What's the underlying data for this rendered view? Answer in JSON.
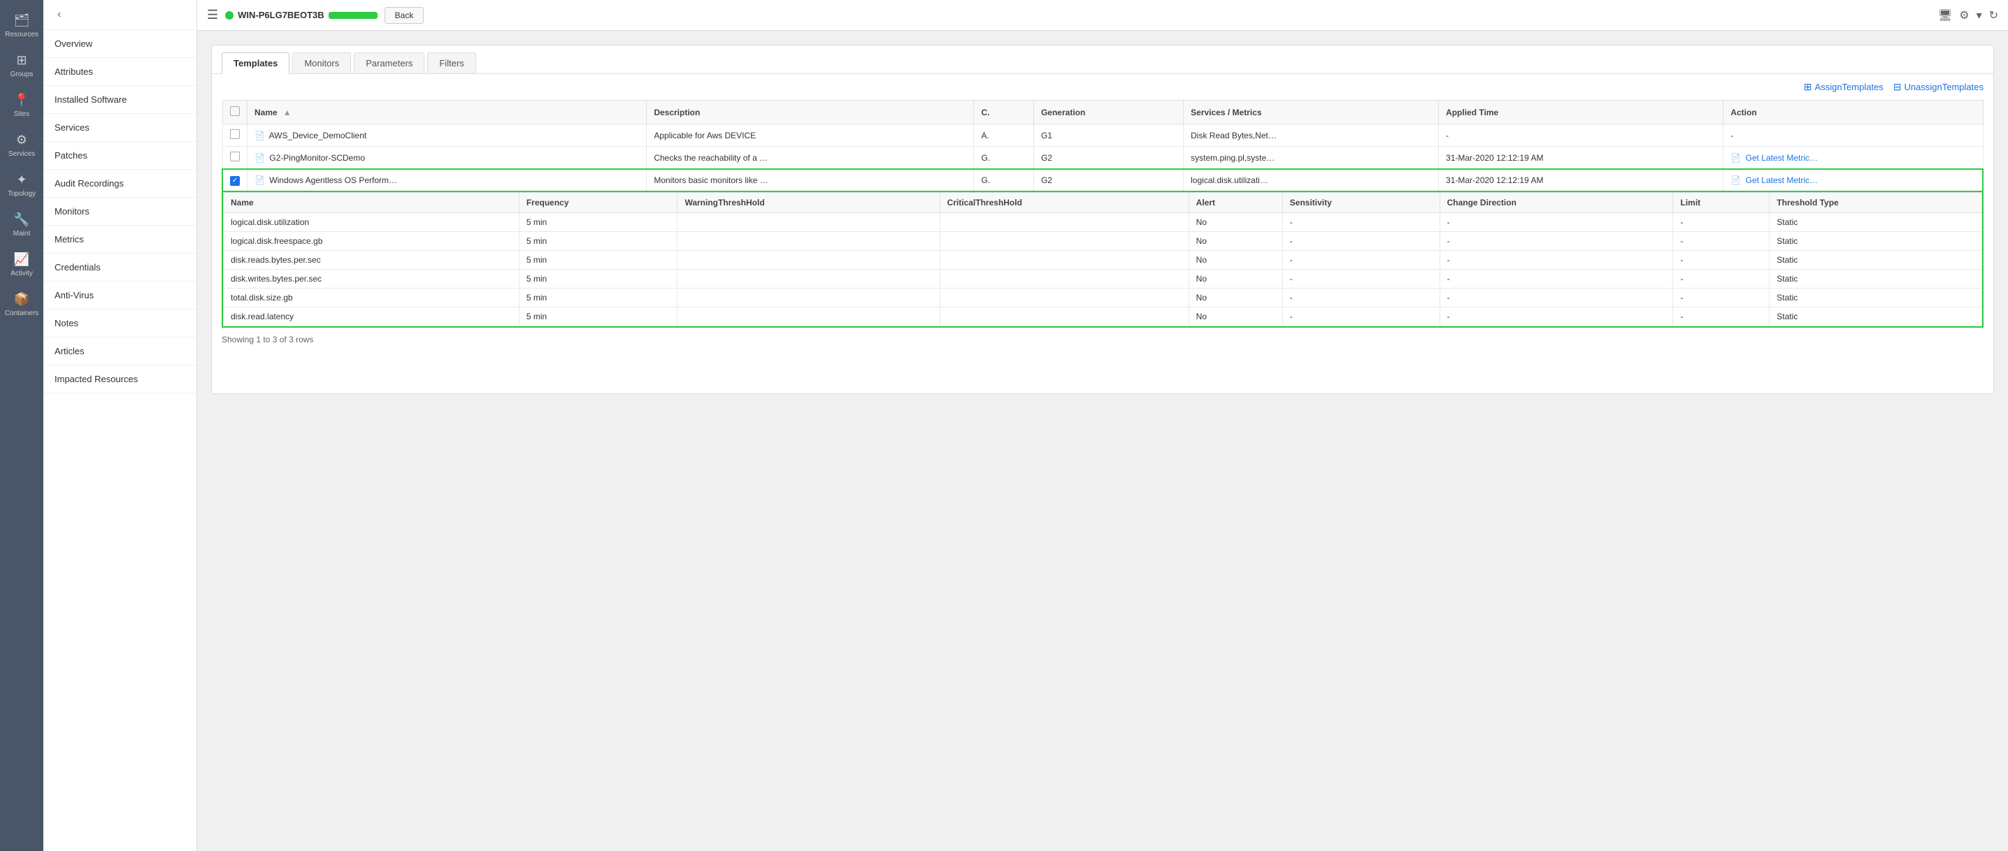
{
  "iconNav": {
    "items": [
      {
        "id": "resources",
        "icon": "🗂",
        "label": "Resources"
      },
      {
        "id": "groups",
        "icon": "⊞",
        "label": "Groups"
      },
      {
        "id": "sites",
        "icon": "📍",
        "label": "Sites"
      },
      {
        "id": "services",
        "icon": "⚙",
        "label": "Services"
      },
      {
        "id": "topology",
        "icon": "✦",
        "label": "Topology"
      },
      {
        "id": "maint",
        "icon": "🔧",
        "label": "Maint"
      },
      {
        "id": "activity",
        "icon": "📈",
        "label": "Activity"
      },
      {
        "id": "containers",
        "icon": "📦",
        "label": "Containers"
      }
    ]
  },
  "sidebar": {
    "items": [
      "Overview",
      "Attributes",
      "Installed Software",
      "Services",
      "Patches",
      "Audit Recordings",
      "Monitors",
      "Metrics",
      "Credentials",
      "Anti-Virus",
      "Notes",
      "Articles",
      "Impacted Resources"
    ]
  },
  "topbar": {
    "deviceName": "WIN-P6LG7BEOT3B",
    "backLabel": "Back"
  },
  "tabs": [
    {
      "id": "templates",
      "label": "Templates",
      "active": true
    },
    {
      "id": "monitors",
      "label": "Monitors",
      "active": false
    },
    {
      "id": "parameters",
      "label": "Parameters",
      "active": false
    },
    {
      "id": "filters",
      "label": "Filters",
      "active": false
    }
  ],
  "actions": {
    "assignLabel": "AssignTemplates",
    "unassignLabel": "UnassignTemplates"
  },
  "table": {
    "headers": [
      "Name",
      "Description",
      "C.",
      "Generation",
      "Services / Metrics",
      "Applied Time",
      "Action"
    ],
    "rows": [
      {
        "checked": false,
        "name": "AWS_Device_DemoClient",
        "description": "Applicable for Aws DEVICE",
        "c": "A.",
        "generation": "G1",
        "servicesMetrics": "Disk Read Bytes,Net…",
        "appliedTime": "-",
        "action": "-",
        "expanded": false
      },
      {
        "checked": false,
        "name": "G2-PingMonitor-SCDemo",
        "description": "Checks the reachability of a …",
        "c": "G.",
        "generation": "G2",
        "servicesMetrics": "system.ping.pl,syste…",
        "appliedTime": "31-Mar-2020 12:12:19 AM",
        "action": "Get Latest Metric…",
        "expanded": false
      },
      {
        "checked": true,
        "name": "Windows Agentless OS Perform…",
        "description": "Monitors basic monitors like …",
        "c": "G.",
        "generation": "G2",
        "servicesMetrics": "logical.disk.utilizati…",
        "appliedTime": "31-Mar-2020 12:12:19 AM",
        "action": "Get Latest Metric…",
        "expanded": true
      }
    ],
    "expandedSubHeaders": [
      "Name",
      "Frequency",
      "WarningThreshHold",
      "CriticalThreshHold",
      "Alert",
      "Sensitivity",
      "Change Direction",
      "Limit",
      "Threshold Type"
    ],
    "expandedSubRows": [
      {
        "name": "logical.disk.utilization",
        "frequency": "5 min",
        "warningThresh": "",
        "criticalThresh": "",
        "alert": "No",
        "sensitivity": "-",
        "changeDirection": "-",
        "limit": "-",
        "thresholdType": "Static"
      },
      {
        "name": "logical.disk.freespace.gb",
        "frequency": "5 min",
        "warningThresh": "",
        "criticalThresh": "",
        "alert": "No",
        "sensitivity": "-",
        "changeDirection": "-",
        "limit": "-",
        "thresholdType": "Static"
      },
      {
        "name": "disk.reads.bytes.per.sec",
        "frequency": "5 min",
        "warningThresh": "",
        "criticalThresh": "",
        "alert": "No",
        "sensitivity": "-",
        "changeDirection": "-",
        "limit": "-",
        "thresholdType": "Static"
      },
      {
        "name": "disk.writes.bytes.per.sec",
        "frequency": "5 min",
        "warningThresh": "",
        "criticalThresh": "",
        "alert": "No",
        "sensitivity": "-",
        "changeDirection": "-",
        "limit": "-",
        "thresholdType": "Static"
      },
      {
        "name": "total.disk.size.gb",
        "frequency": "5 min",
        "warningThresh": "",
        "criticalThresh": "",
        "alert": "No",
        "sensitivity": "-",
        "changeDirection": "-",
        "limit": "-",
        "thresholdType": "Static"
      },
      {
        "name": "disk.read.latency",
        "frequency": "5 min",
        "warningThresh": "",
        "criticalThresh": "",
        "alert": "No",
        "sensitivity": "-",
        "changeDirection": "-",
        "limit": "-",
        "thresholdType": "Static"
      }
    ]
  },
  "footer": {
    "showingText": "Showing 1 to 3 of 3 rows"
  }
}
